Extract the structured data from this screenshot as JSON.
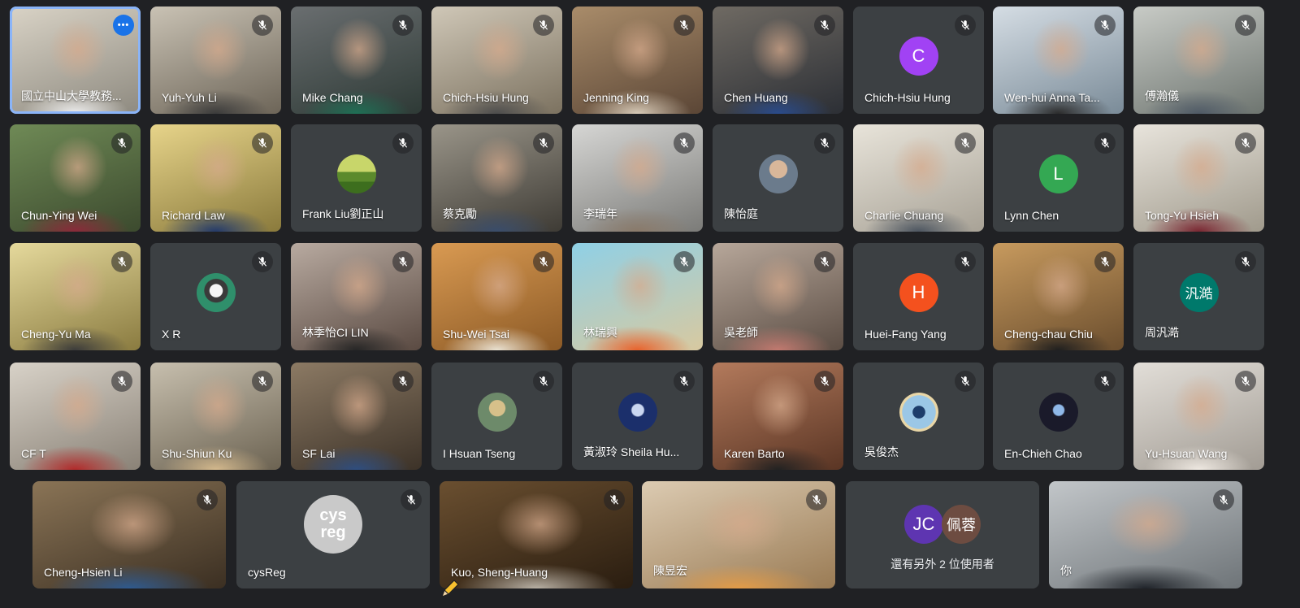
{
  "participants": [
    {
      "name": "國立中山大學教務...",
      "kind": "video",
      "bg1": "#d9d3c6",
      "bg2": "#8e8a80",
      "shirt": "#efefef",
      "more": true,
      "active": true
    },
    {
      "name": "Yuh-Yuh Li",
      "kind": "video",
      "bg1": "#c9c2b4",
      "bg2": "#6d6558",
      "shirt": "#3b3b3b"
    },
    {
      "name": "Mike Chang",
      "kind": "video",
      "bg1": "#6a6e70",
      "bg2": "#2e3a36",
      "shirt": "#1f6f55"
    },
    {
      "name": "Chich-Hsiu Hung",
      "kind": "video",
      "bg1": "#cfc7b7",
      "bg2": "#7c7260",
      "shirt": "#4d4d4d"
    },
    {
      "name": "Jenning King",
      "kind": "video",
      "bg1": "#a98c6a",
      "bg2": "#5b4636",
      "shirt": "#d8cbb8"
    },
    {
      "name": "Chen Huang",
      "kind": "video",
      "bg1": "#6f6a63",
      "bg2": "#2c2f35",
      "shirt": "#2a4b8c"
    },
    {
      "name": "Chich-Hsiu Hung",
      "kind": "avatar",
      "letter": "C",
      "color": "#a142f4"
    },
    {
      "name": "Wen-hui Anna Ta...",
      "kind": "video",
      "bg1": "#d5dde4",
      "bg2": "#7a8b98",
      "shirt": "#2b2b2b"
    },
    {
      "name": "傅瀚儀",
      "kind": "video",
      "bg1": "#c8cbc6",
      "bg2": "#6e7570",
      "shirt": "#4f5a66"
    },
    {
      "name": "Chun-Ying Wei",
      "kind": "video",
      "bg1": "#6f8a56",
      "bg2": "#3c4a2e",
      "shirt": "#8c2a3a"
    },
    {
      "name": "Richard Law",
      "kind": "video",
      "bg1": "#e7d48a",
      "bg2": "#8a7a3c",
      "shirt": "#233a6b"
    },
    {
      "name": "Frank Liu劉正山",
      "kind": "photo-avatar",
      "photo": "landscape"
    },
    {
      "name": "蔡克勵",
      "kind": "video",
      "bg1": "#9a9589",
      "bg2": "#3e3b35",
      "shirt": "#3a4d6b"
    },
    {
      "name": "李瑞年",
      "kind": "video",
      "bg1": "#d6d6d4",
      "bg2": "#7b7b78",
      "shirt": "#8a7a6a"
    },
    {
      "name": "陳怡庭",
      "kind": "photo-avatar",
      "photo": "person"
    },
    {
      "name": "Charlie Chuang",
      "kind": "video",
      "bg1": "#e8e4da",
      "bg2": "#a8a296",
      "shirt": "#4c5560"
    },
    {
      "name": "Lynn Chen",
      "kind": "avatar",
      "letter": "L",
      "color": "#34a853"
    },
    {
      "name": "Tong-Yu Hsieh",
      "kind": "video",
      "bg1": "#e8e4dc",
      "bg2": "#a09a8c",
      "shirt": "#7a2631"
    },
    {
      "name": "Cheng-Yu Ma",
      "kind": "video",
      "bg1": "#e5d99c",
      "bg2": "#8a7b40",
      "shirt": "#3b3b3b"
    },
    {
      "name": "X R",
      "kind": "photo-avatar",
      "photo": "husky"
    },
    {
      "name": "林季怡CI LIN",
      "kind": "video",
      "bg1": "#b8aaa0",
      "bg2": "#5a4a42",
      "shirt": "#262626"
    },
    {
      "name": "Shu-Wei Tsai",
      "kind": "video",
      "bg1": "#d99a52",
      "bg2": "#8c5a26",
      "shirt": "#eae2d2"
    },
    {
      "name": "林瑞興",
      "kind": "video",
      "bg1": "#8fd0e6",
      "bg2": "#d8c9a0",
      "shirt": "#e8622c"
    },
    {
      "name": "吳老師",
      "kind": "video",
      "bg1": "#b7a79a",
      "bg2": "#5b4d44",
      "shirt": "#c37a70"
    },
    {
      "name": "Huei-Fang Yang",
      "kind": "avatar",
      "letter": "H",
      "color": "#f4511e"
    },
    {
      "name": "Cheng-chau Chiu",
      "kind": "video",
      "bg1": "#c79a5e",
      "bg2": "#6b4e2e",
      "shirt": "#1f1f1f"
    },
    {
      "name": "周汎澔",
      "kind": "avatar",
      "letter": "汎澔",
      "color": "#00796b"
    },
    {
      "name": "CF T",
      "kind": "video",
      "bg1": "#d8d2c8",
      "bg2": "#8a8277",
      "shirt": "#b22a2a"
    },
    {
      "name": "Shu-Shiun Ku",
      "kind": "video",
      "bg1": "#c7bfae",
      "bg2": "#6c6352",
      "shirt": "#d4b98d"
    },
    {
      "name": "SF Lai",
      "kind": "video",
      "bg1": "#8c7a64",
      "bg2": "#3c3228",
      "shirt": "#2f4e80"
    },
    {
      "name": "I Hsuan Tseng",
      "kind": "photo-avatar",
      "photo": "figure"
    },
    {
      "name": "黃淑玲 Sheila Hu...",
      "kind": "photo-avatar",
      "photo": "night"
    },
    {
      "name": "Karen Barto",
      "kind": "video",
      "bg1": "#b37a5c",
      "bg2": "#5a3524",
      "shirt": "#222222"
    },
    {
      "name": "吳俊杰",
      "kind": "photo-avatar",
      "photo": "beach"
    },
    {
      "name": "En-Chieh Chao",
      "kind": "photo-avatar",
      "photo": "dark"
    },
    {
      "name": "Yu-Hsuan Wang",
      "kind": "video",
      "bg1": "#e2ded8",
      "bg2": "#a29c94",
      "shirt": "#efe9e2"
    },
    {
      "name": "Cheng-Hsien Li",
      "kind": "video",
      "bg1": "#8a7456",
      "bg2": "#3b2f22",
      "shirt": "#2f5a8f"
    },
    {
      "name": "cysReg",
      "kind": "avatar-big",
      "letter": "cys reg",
      "color": "#c9c9c9"
    },
    {
      "name": "Kuo, Sheng-Huang",
      "kind": "video",
      "bg1": "#6a4f30",
      "bg2": "#2a1d10",
      "shirt": "#b8b0a4"
    },
    {
      "name": "陳昱宏",
      "kind": "video",
      "bg1": "#dccbb2",
      "bg2": "#9a7b54",
      "shirt": "#e39c48"
    },
    {
      "name": "",
      "kind": "others",
      "label": "還有另外 2 位使用者",
      "a1": "JC",
      "c1": "#5e35b1",
      "a2": "佩蓉",
      "c2": "#6d4c41"
    },
    {
      "name": "你",
      "kind": "video",
      "bg1": "#c2c6c9",
      "bg2": "#6e7478",
      "shirt": "#20242a"
    }
  ],
  "icons": {
    "mic_off": "mic-off-icon",
    "more": "more-options-icon",
    "cursor": "pencil-cursor-icon"
  },
  "more_glyph": "•••"
}
